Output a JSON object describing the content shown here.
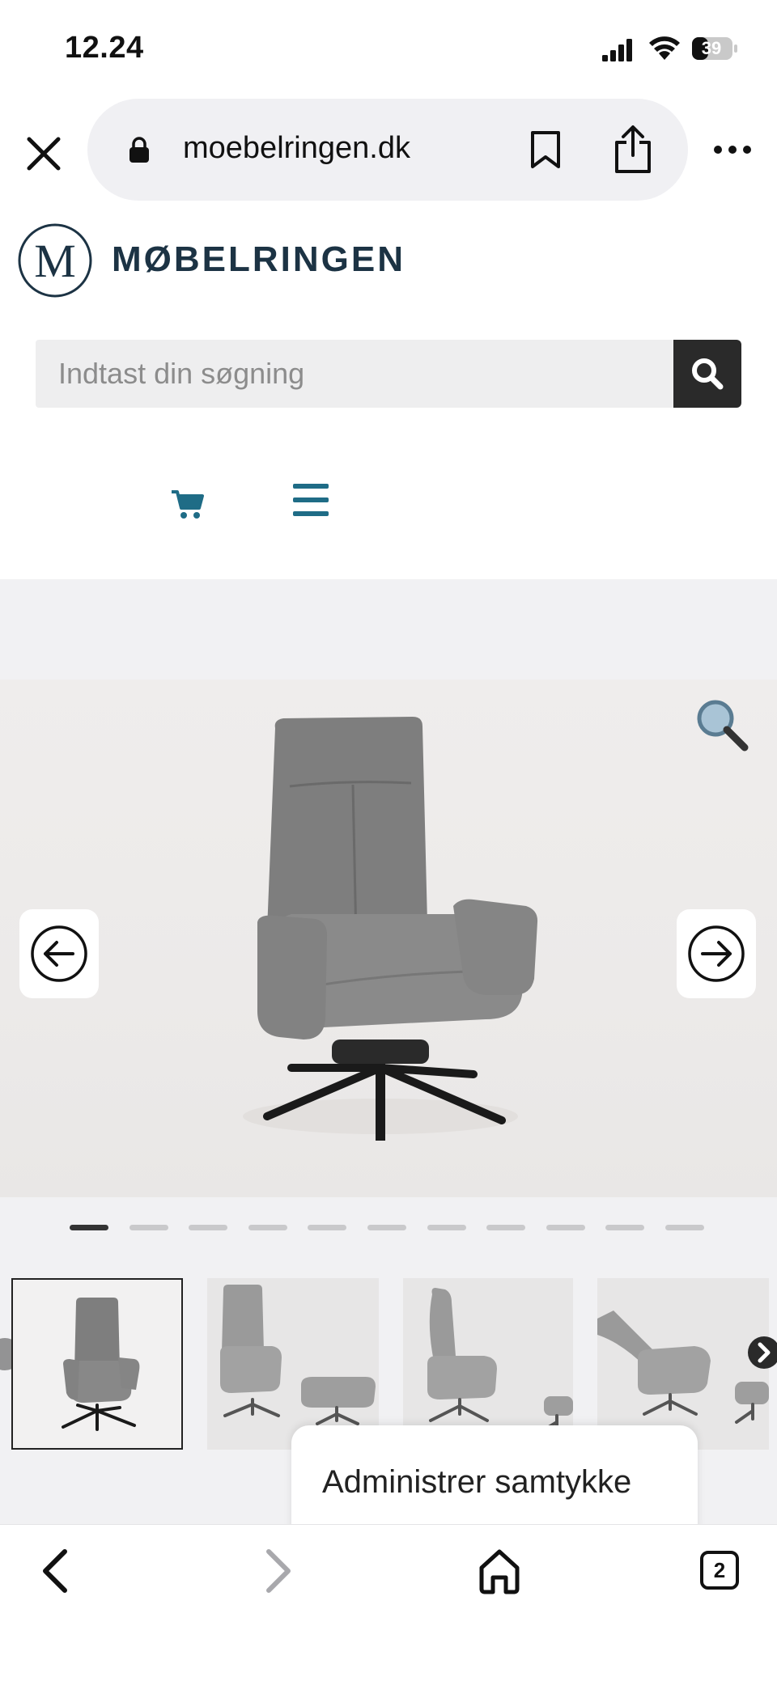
{
  "status_bar": {
    "time": "12.24",
    "battery": "39",
    "icons": [
      "signal-icon",
      "wifi-icon",
      "battery-icon"
    ]
  },
  "browser": {
    "url": "moebelringen.dk",
    "icons": [
      "close-icon",
      "lock-icon",
      "bookmark-icon",
      "share-icon",
      "more-icon"
    ]
  },
  "header": {
    "logo_letter": "M",
    "logo_text": "MØBELRINGEN",
    "brand_color": "#1c3344",
    "accent_color": "#1f6c86"
  },
  "search": {
    "placeholder": "Indtast din søgning",
    "button_icon": "search-icon"
  },
  "nav": {
    "icons": [
      "cart-icon",
      "menu-icon"
    ]
  },
  "gallery": {
    "image_count": 11,
    "active_index": 0,
    "icons": [
      "zoom-icon",
      "arrow-left-icon",
      "arrow-right-icon"
    ],
    "thumbnails": [
      "chair-front",
      "chair-with-footstool",
      "chair-side",
      "chair-reclined"
    ]
  },
  "consent": {
    "label": "Administrer samtykke"
  },
  "toolbar": {
    "tabs_count": "2",
    "icons": [
      "back-icon",
      "forward-icon",
      "home-icon",
      "tabs-icon"
    ]
  }
}
